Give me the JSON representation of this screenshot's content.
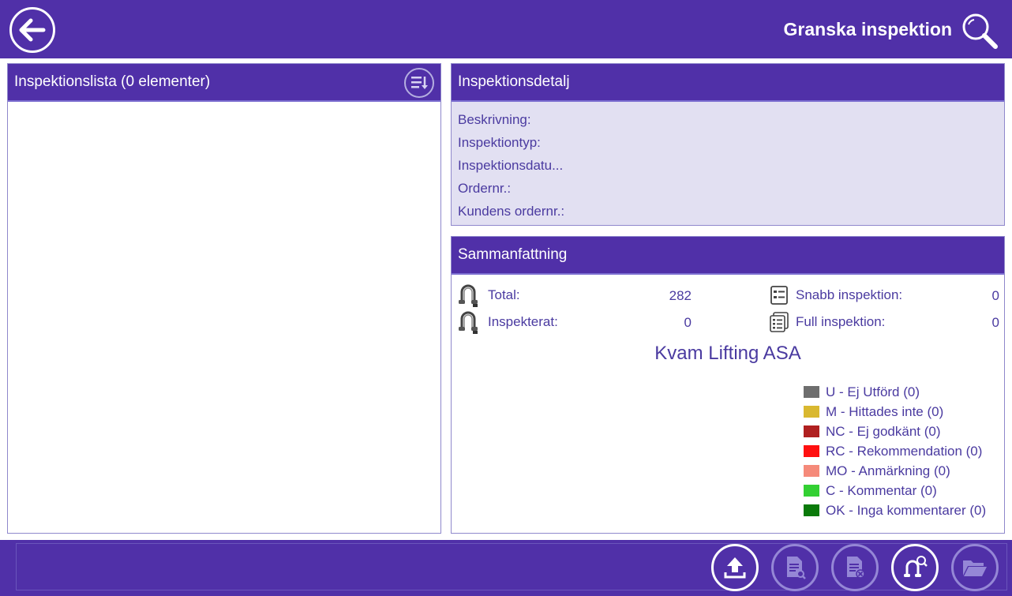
{
  "header": {
    "title": "Granska inspektion"
  },
  "list_panel": {
    "title": "Inspektionslista (0 elementer)"
  },
  "detail_panel": {
    "title": "Inspektionsdetalj",
    "rows": [
      {
        "label": "Beskrivning:"
      },
      {
        "label": "Inspektiontyp:"
      },
      {
        "label": "Inspektionsdatu..."
      },
      {
        "label": "Ordernr.:"
      },
      {
        "label": "Kundens ordernr.:"
      }
    ]
  },
  "summary_panel": {
    "title": "Sammanfattning",
    "total_label": "Total:",
    "total_value": "282",
    "inspected_label": "Inspekterat:",
    "inspected_value": "0",
    "quick_label": "Snabb inspektion:",
    "quick_value": "0",
    "full_label": "Full inspektion:",
    "full_value": "0",
    "company": "Kvam Lifting ASA",
    "legend": [
      {
        "label": "U - Ej Utförd (0)",
        "color": "#6e6e6e"
      },
      {
        "label": "M - Hittades inte (0)",
        "color": "#d9b830"
      },
      {
        "label": "NC - Ej godkänt (0)",
        "color": "#b02020"
      },
      {
        "label": "RC - Rekommendation (0)",
        "color": "#ff1010"
      },
      {
        "label": "MO - Anmärkning (0)",
        "color": "#f58a7a"
      },
      {
        "label": "C - Kommentar (0)",
        "color": "#33d033"
      },
      {
        "label": "OK - Inga kommentarer (0)",
        "color": "#0a7a0a"
      }
    ]
  },
  "toolbar": {
    "buttons": [
      {
        "icon": "upload-icon",
        "enabled": true
      },
      {
        "icon": "document-search-icon",
        "enabled": false
      },
      {
        "icon": "document-delete-icon",
        "enabled": false
      },
      {
        "icon": "shackle-search-icon",
        "enabled": true
      },
      {
        "icon": "folder-open-icon",
        "enabled": false
      }
    ]
  }
}
